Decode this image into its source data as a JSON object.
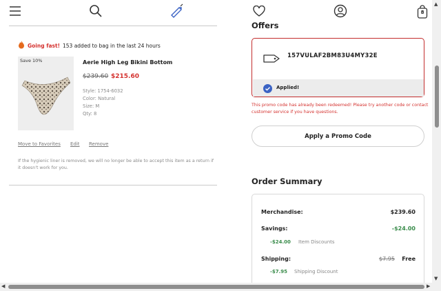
{
  "header": {
    "icons": [
      "menu-icon",
      "search-icon",
      "tag-icon",
      "heart-icon",
      "account-icon",
      "bag-icon"
    ],
    "bag_count": "8"
  },
  "bag_item": {
    "hurry_label": "Going fast!",
    "hurry_text": "153 added to bag in the last 24 hours",
    "badge": "Save 10%",
    "name": "Aerie High Leg Bikini Bottom",
    "price_original": "$239.60",
    "price_sale": "$215.60",
    "style": "Style: 1754-6032",
    "color": "Color: Natural",
    "size": "Size: M",
    "qty": "Qty: 8",
    "actions": {
      "move": "Move to Favorites",
      "edit": "Edit",
      "remove": "Remove"
    },
    "note": "If the hygienic liner is removed, we will no longer be able to accept this item as a return if it doesn't work for you."
  },
  "offers": {
    "title": "Offers",
    "promo_code": "157VULAF2BM83U4MY32E",
    "applied": "Applied!",
    "error": "This promo code has already been redeemed! Please try another code or contact customer service if you have questions.",
    "apply_button": "Apply a Promo Code"
  },
  "order_summary": {
    "title": "Order Summary",
    "merchandise_label": "Merchandise:",
    "merchandise_value": "$239.60",
    "savings_label": "Savings:",
    "savings_value": "-$24.00",
    "item_discount_amount": "-$24.00",
    "item_discount_label": "Item Discounts",
    "shipping_label": "Shipping:",
    "shipping_original": "$7.95",
    "shipping_value": "Free",
    "shipping_discount_amount": "-$7.95",
    "shipping_discount_label": "Shipping Discount"
  },
  "colors": {
    "error_red": "#d4322f",
    "savings_green": "#3a8c4b",
    "applied_blue": "#3b63c4"
  }
}
